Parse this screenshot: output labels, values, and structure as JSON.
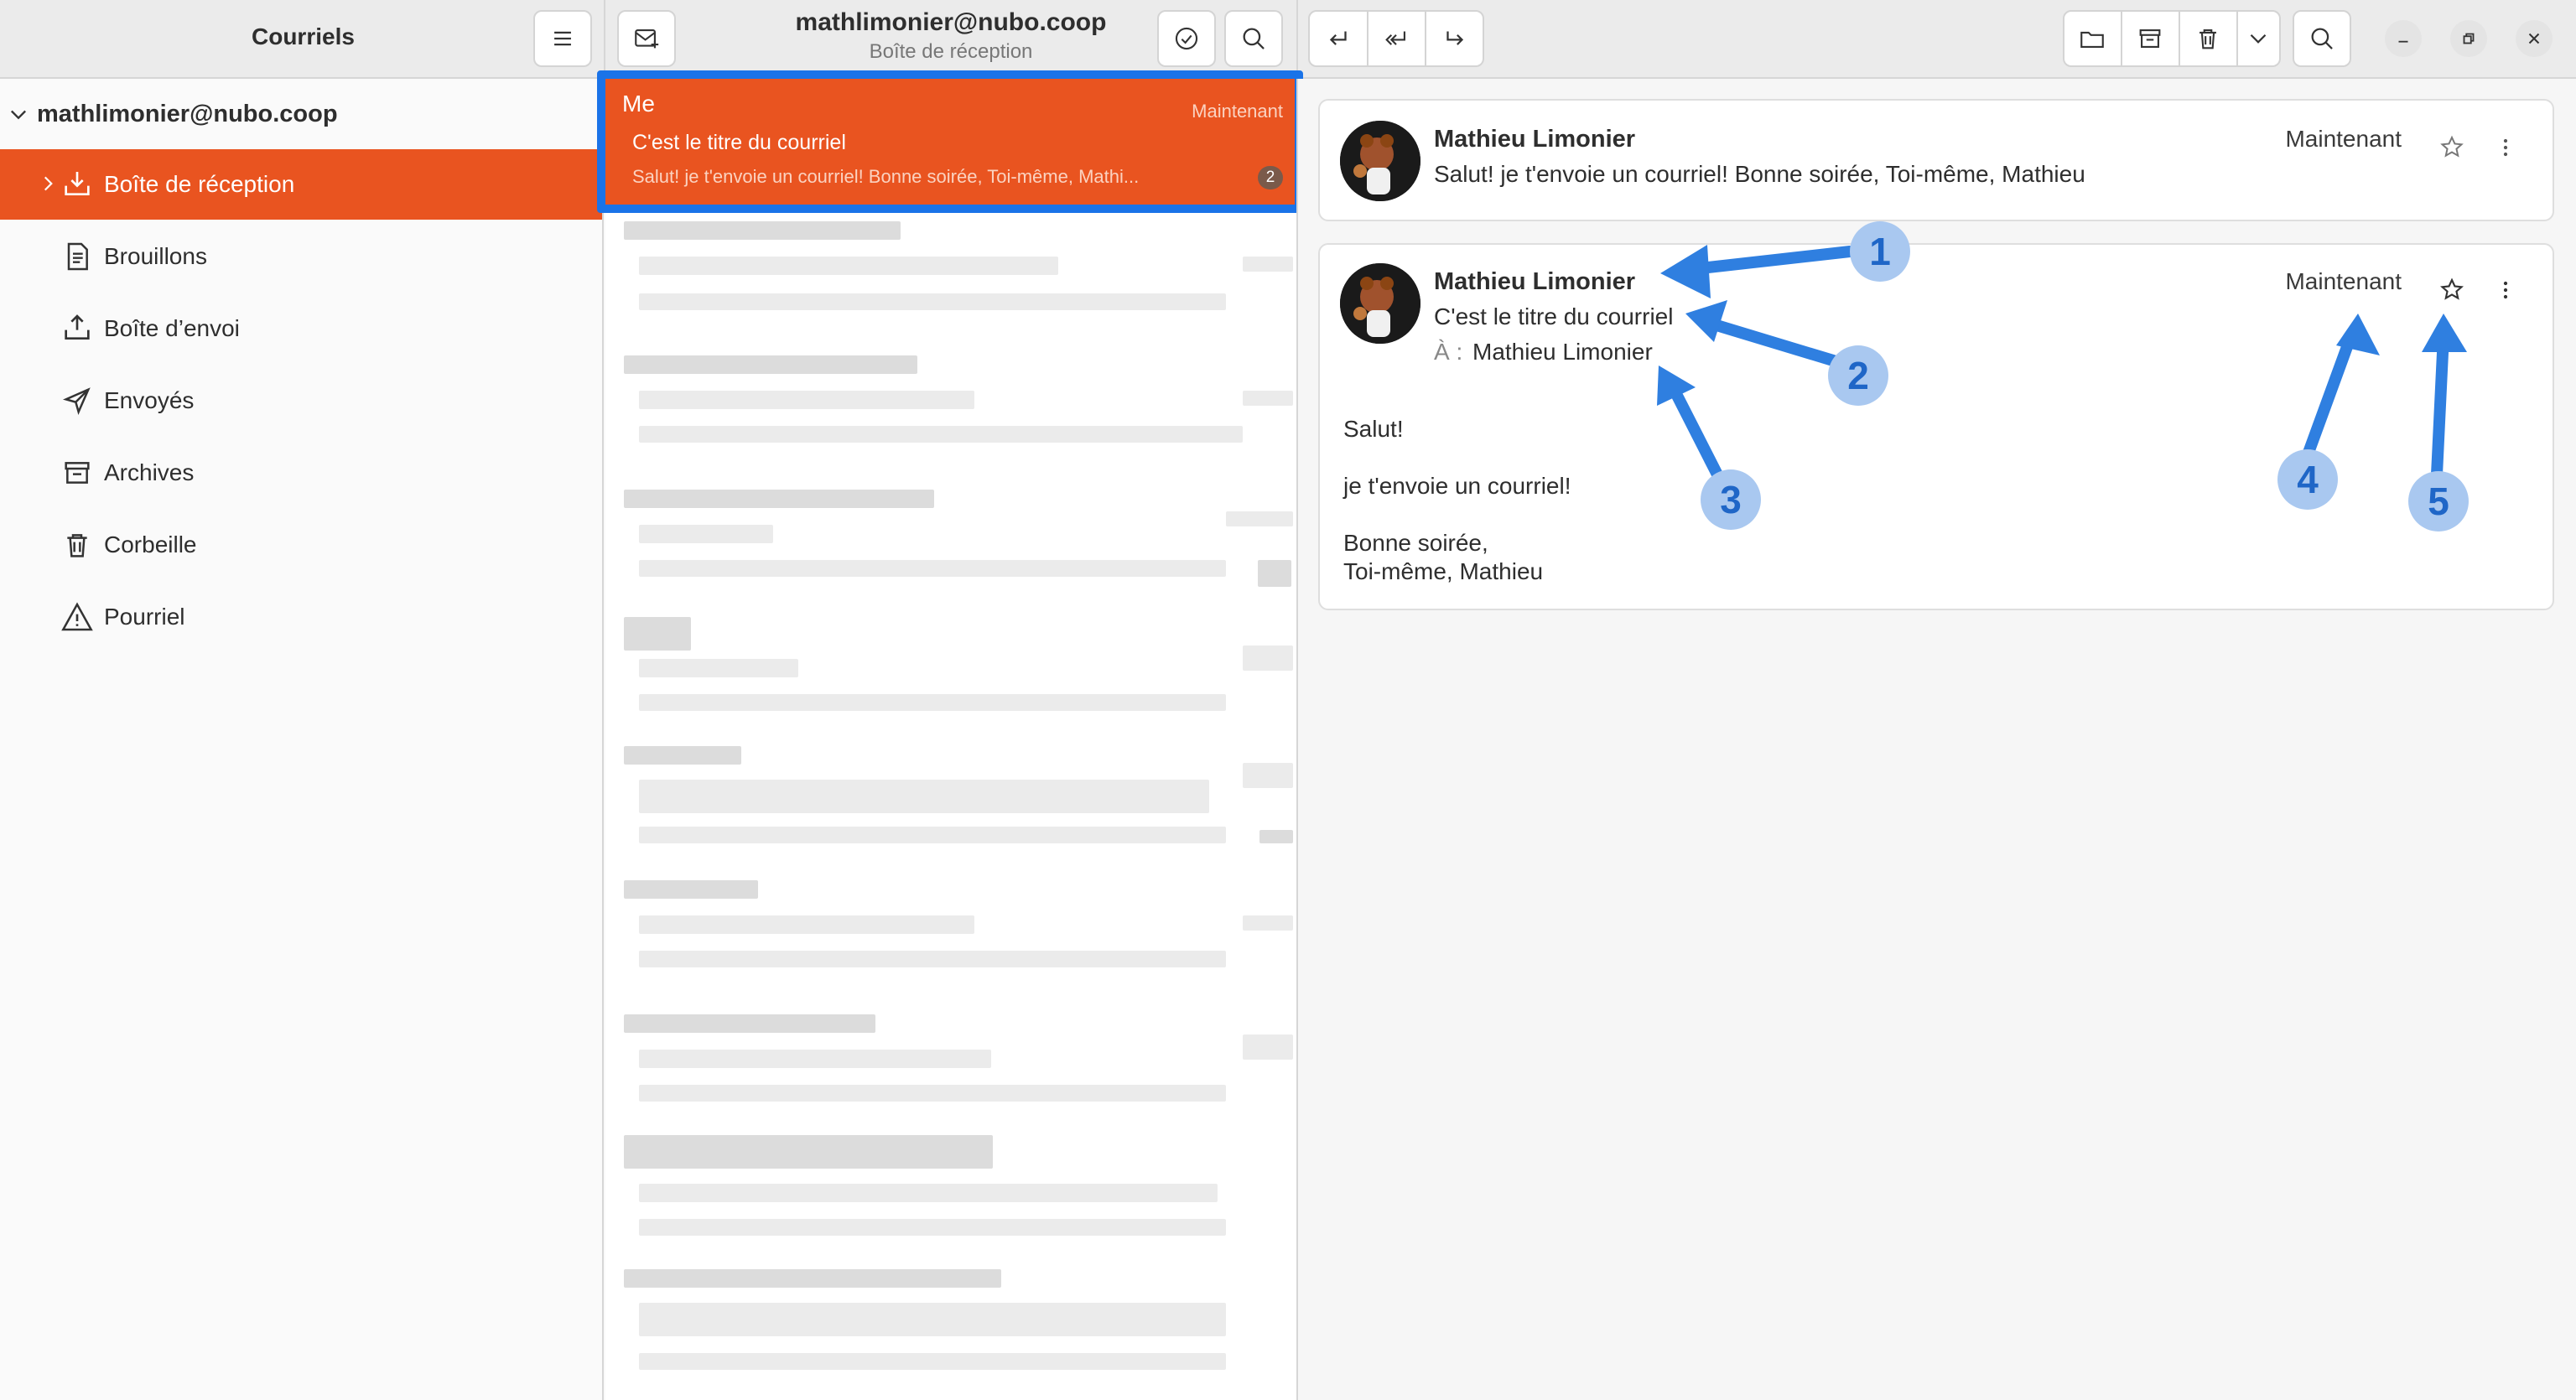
{
  "header": {
    "sidebar_title": "Courriels",
    "account": "mathlimonier@nubo.coop",
    "folder_subtitle": "Boîte de réception"
  },
  "sidebar": {
    "account": "mathlimonier@nubo.coop",
    "folders": [
      {
        "label": "Boîte de réception",
        "icon": "inbox-icon",
        "active": true
      },
      {
        "label": "Brouillons",
        "icon": "drafts-icon"
      },
      {
        "label": "Boîte d’envoi",
        "icon": "outbox-icon"
      },
      {
        "label": "Envoyés",
        "icon": "sent-icon"
      },
      {
        "label": "Archives",
        "icon": "archive-icon"
      },
      {
        "label": "Corbeille",
        "icon": "trash-icon"
      },
      {
        "label": "Pourriel",
        "icon": "spam-icon"
      }
    ]
  },
  "message_list": {
    "selected": {
      "sender": "Me",
      "time": "Maintenant",
      "subject": "C'est le titre du courriel",
      "preview": "Salut! je t'envoie un courriel! Bonne soirée, Toi-même, Mathi...",
      "count": "2"
    }
  },
  "conversation": {
    "collapsed": {
      "sender": "Mathieu Limonier",
      "time": "Maintenant",
      "preview": "Salut! je t'envoie un courriel! Bonne soirée, Toi-même, Mathieu"
    },
    "expanded": {
      "sender": "Mathieu Limonier",
      "time": "Maintenant",
      "subject": "C'est le titre du courriel",
      "to_label": "À :",
      "to": "Mathieu Limonier",
      "body": [
        "Salut!",
        "je t'envoie un courriel!",
        "Bonne soirée,",
        "Toi-même, Mathieu"
      ]
    }
  },
  "annotations": [
    "1",
    "2",
    "3",
    "4",
    "5"
  ],
  "colors": {
    "accent": "#e95420",
    "selection_outline": "#1a73e8",
    "annotation": "#2f7fe0"
  }
}
